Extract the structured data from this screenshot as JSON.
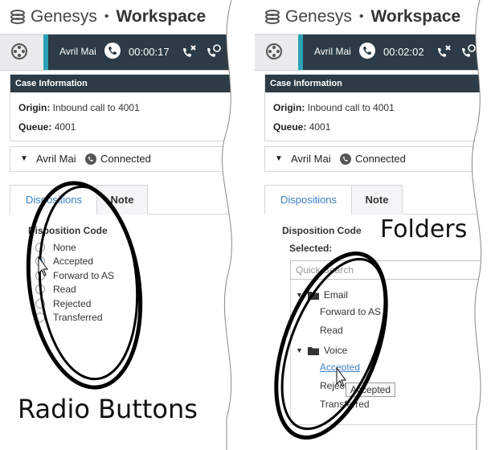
{
  "app": {
    "brand": "Genesys",
    "separator": "•",
    "product": "Workspace"
  },
  "left": {
    "call": {
      "contact": "Avril Mai",
      "timer": "00:00:17"
    },
    "case": {
      "title": "Case Information",
      "origin_label": "Origin:",
      "origin_value": "Inbound call to 4001",
      "queue_label": "Queue:",
      "queue_value": "4001"
    },
    "party": {
      "name": "Avril Mai",
      "status": "Connected"
    },
    "tabs": [
      "Dispositions",
      "Note"
    ],
    "disposition_label": "Disposition Code",
    "options": [
      "None",
      "Accepted",
      "Forward to AS",
      "Read",
      "Rejected",
      "Transferred"
    ],
    "selected_index": 1,
    "annotation": "Radio Buttons"
  },
  "right": {
    "call": {
      "contact": "Avril Mai",
      "timer": "00:02:02"
    },
    "case": {
      "title": "Case Information",
      "origin_label": "Origin:",
      "origin_value": "Inbound call to 4001",
      "queue_label": "Queue:",
      "queue_value": "4001"
    },
    "party": {
      "name": "Avril Mai",
      "status": "Connected"
    },
    "tabs": [
      "Dispositions",
      "Note"
    ],
    "disposition_label": "Disposition Code",
    "selected_label": "Selected:",
    "search_placeholder": "Quick Search",
    "folders": [
      {
        "name": "Email",
        "items": [
          "Forward to AS",
          "Read"
        ]
      },
      {
        "name": "Voice",
        "items": [
          "Accepted",
          "Reject",
          "Transferred"
        ]
      }
    ],
    "tooltip": "Accepted",
    "annotation": "Folders"
  },
  "colors": {
    "dark": "#2c3b45",
    "accent": "#2aa1b6",
    "link": "#3b7fc4"
  }
}
